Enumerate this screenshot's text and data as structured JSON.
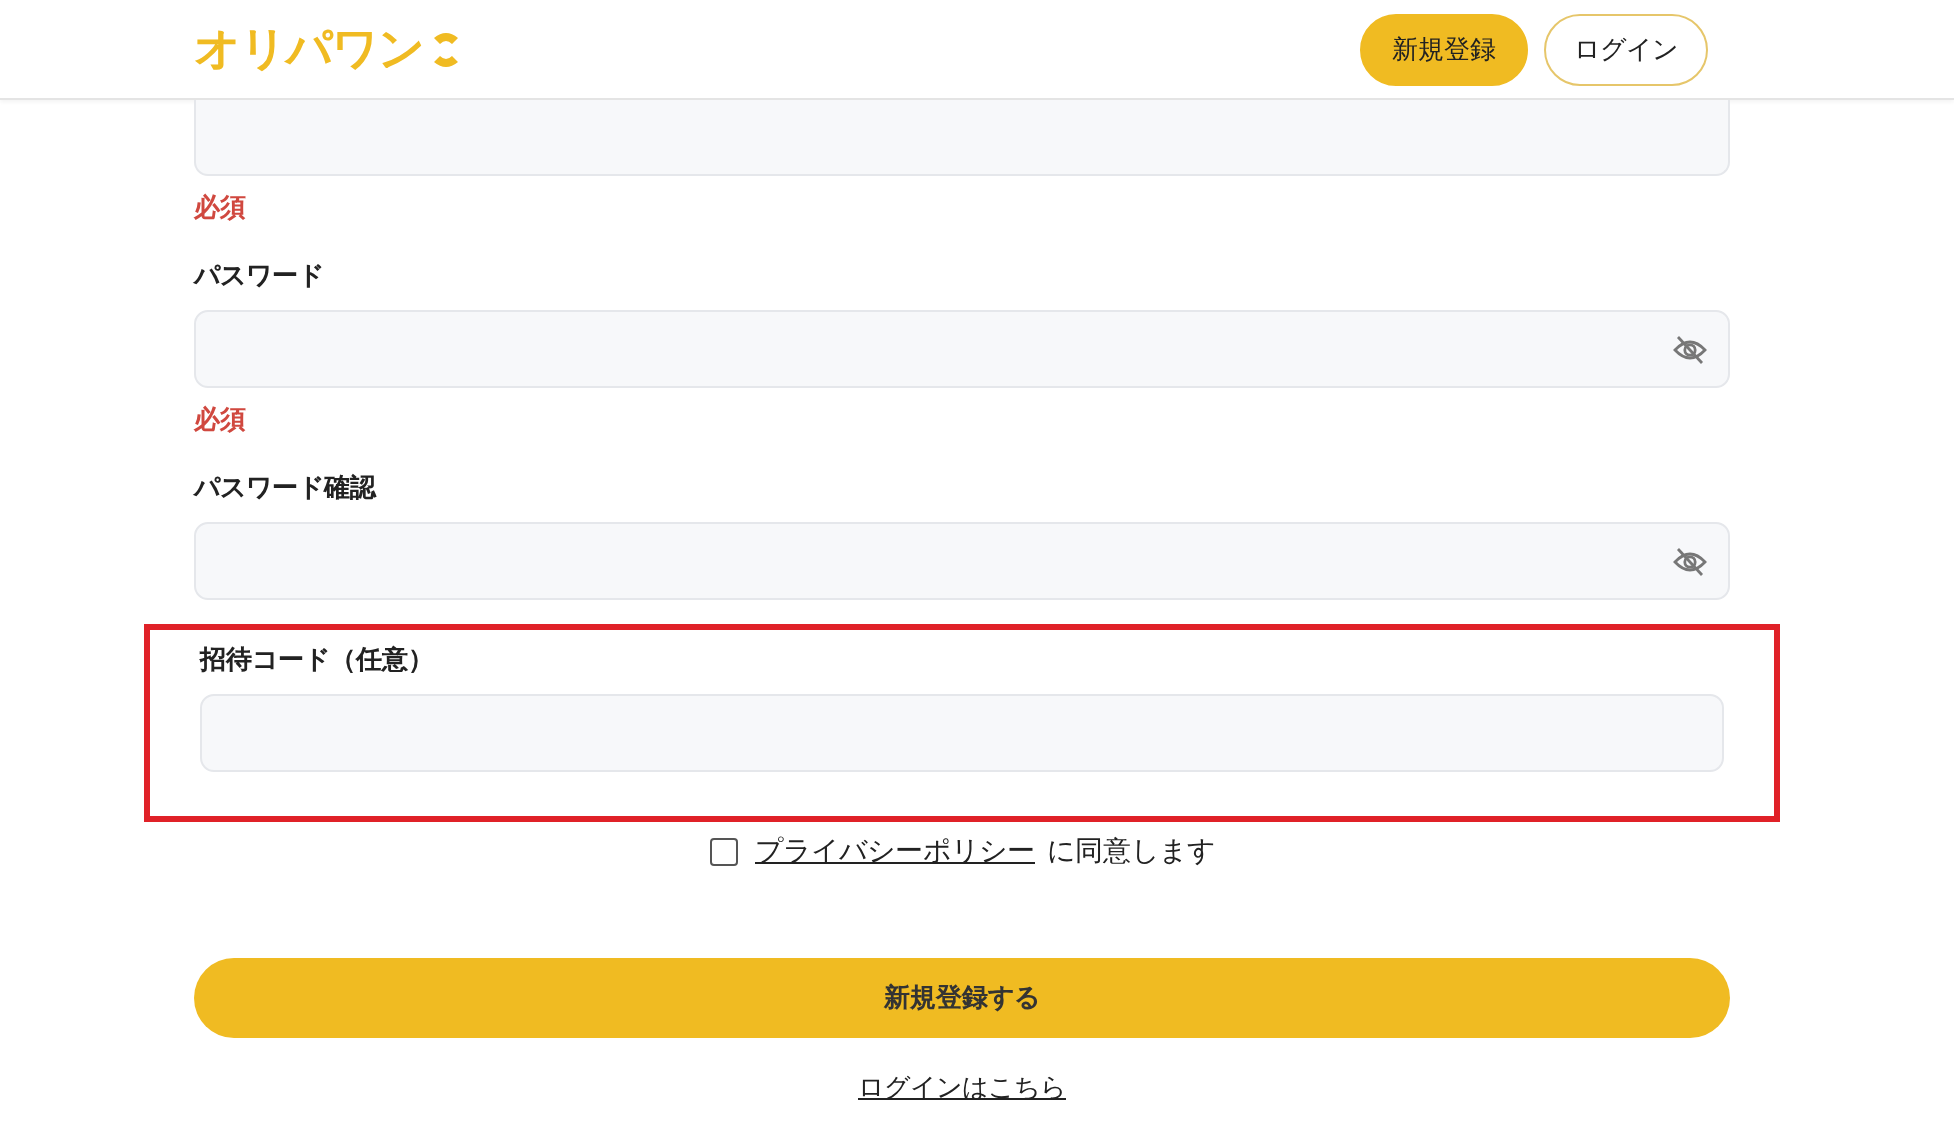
{
  "header": {
    "logo": "オリパワン",
    "buttons": [
      {
        "label": "新規登録",
        "kind": "primary"
      },
      {
        "label": "ログイン",
        "kind": "outline"
      }
    ]
  },
  "form": {
    "fields": [
      {
        "kind": "text",
        "error": "必須"
      },
      {
        "kind": "password",
        "label": "パスワード",
        "error": "必須"
      },
      {
        "kind": "password",
        "label": "パスワード確認"
      }
    ],
    "invite": {
      "label": "招待コード（任意）",
      "highlighted": true
    },
    "consent": {
      "checked": false,
      "link": "プライバシーポリシー",
      "text": "に同意します"
    },
    "submit": "新規登録する",
    "login_link": "ログインはこちら"
  }
}
